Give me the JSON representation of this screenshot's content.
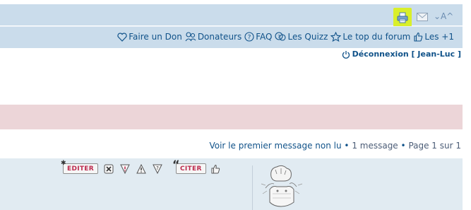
{
  "toolbar": {
    "print_icon": "printer-icon",
    "mail_icon": "envelope-icon",
    "font_size_label": "⌄A^"
  },
  "nav": {
    "items": [
      {
        "label": "Faire un Don",
        "icon": "heart-icon"
      },
      {
        "label": "Donateurs",
        "icon": "donors-icon"
      },
      {
        "label": "FAQ",
        "icon": "help-icon"
      },
      {
        "label": "Les Quizz",
        "icon": "quiz-icon"
      },
      {
        "label": "Le top du forum",
        "icon": "star-icon"
      },
      {
        "label": "Les +1",
        "icon": "thumbs-up-icon"
      }
    ]
  },
  "user": {
    "logout_label": "Déconnexion [ Jean-Luc ]"
  },
  "topic": {
    "first_unread": "Voir le premier message non lu",
    "bullet": "•",
    "message_count": "1 message",
    "page_info": "Page 1 sur 1"
  },
  "post": {
    "edit_label": "EDITER",
    "quote_label": "CITER",
    "icons": [
      "delete-icon",
      "report-icon",
      "warning-icon",
      "info-icon",
      "thumbs-up-icon"
    ]
  },
  "colors": {
    "header_bg": "#cadceb",
    "highlight": "#d9ef2a",
    "link": "#105289",
    "band_pink": "#ecd5d8",
    "post_bg": "#e1ebf2",
    "button_text": "#bc2a4d"
  }
}
